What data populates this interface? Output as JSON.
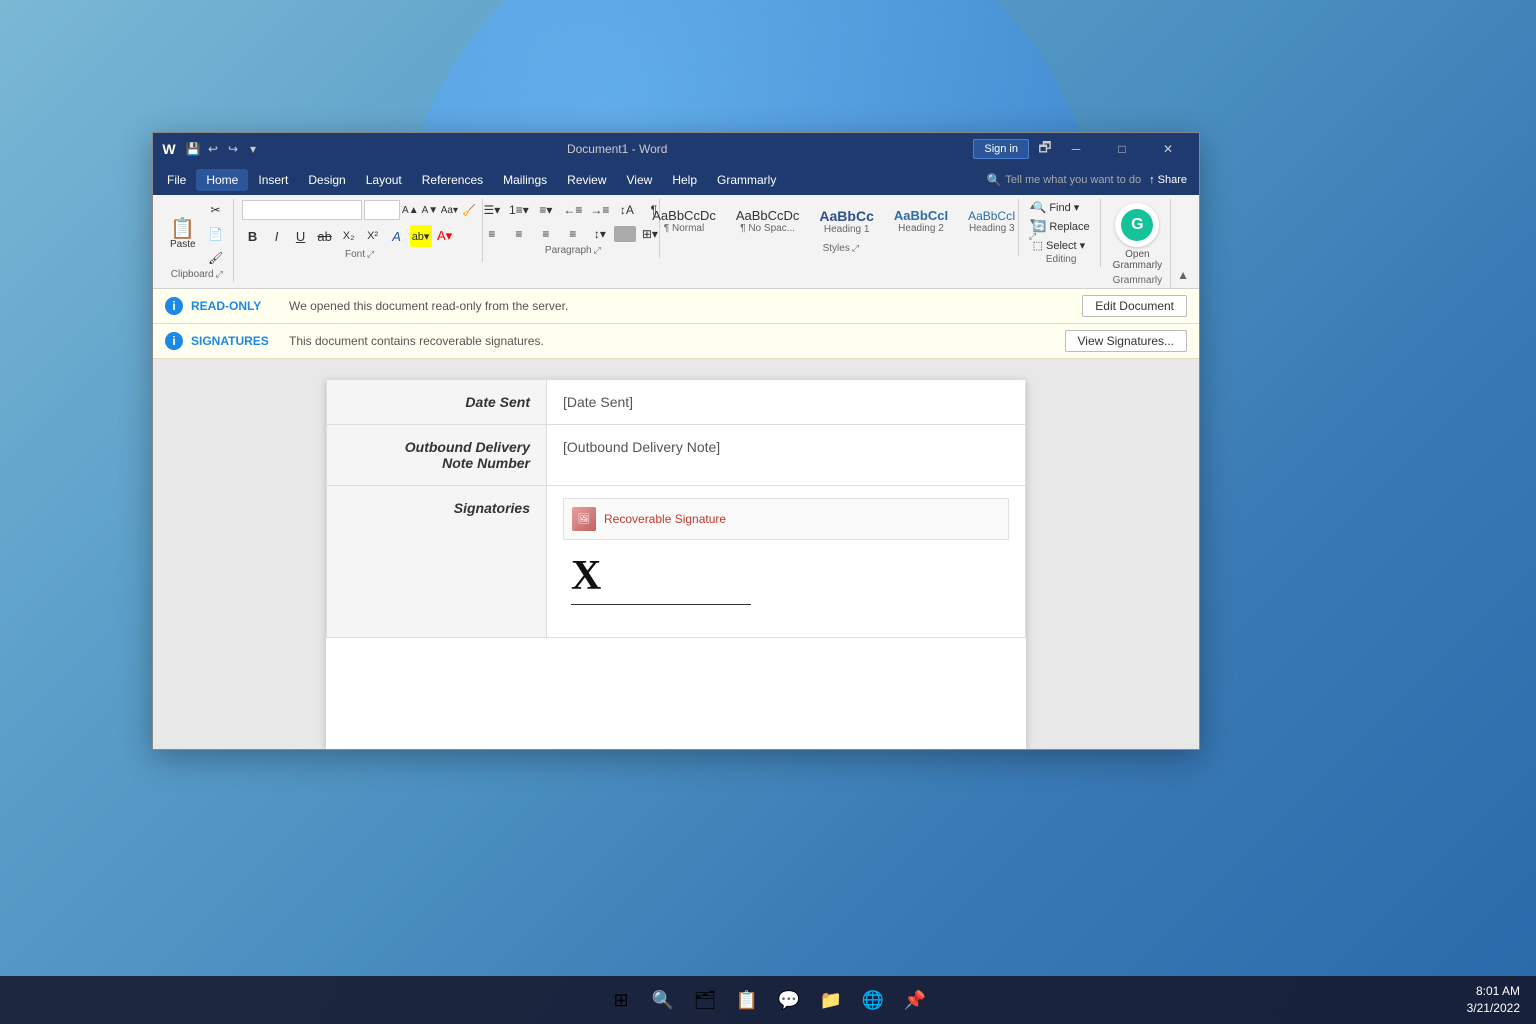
{
  "window": {
    "title": "Document1 - Word",
    "titlebar": {
      "quicksave": "💾",
      "undo": "↩",
      "redo": "↪",
      "more": "▾"
    },
    "controls": {
      "signin_label": "Sign in",
      "restore_label": "🗗",
      "minimize_label": "─",
      "maximize_label": "□",
      "close_label": "✕"
    }
  },
  "menubar": {
    "items": [
      {
        "label": "File",
        "active": false
      },
      {
        "label": "Home",
        "active": true
      },
      {
        "label": "Insert",
        "active": false
      },
      {
        "label": "Design",
        "active": false
      },
      {
        "label": "Layout",
        "active": false
      },
      {
        "label": "References",
        "active": false
      },
      {
        "label": "Mailings",
        "active": false
      },
      {
        "label": "Review",
        "active": false
      },
      {
        "label": "View",
        "active": false
      },
      {
        "label": "Help",
        "active": false
      },
      {
        "label": "Grammarly",
        "active": false
      }
    ],
    "search_placeholder": "Tell me what you want to do",
    "share_label": "Share"
  },
  "ribbon": {
    "groups": [
      {
        "name": "Clipboard",
        "label": "Clipboard"
      },
      {
        "name": "Font",
        "label": "Font"
      },
      {
        "name": "Paragraph",
        "label": "Paragraph"
      },
      {
        "name": "Styles",
        "label": "Styles"
      },
      {
        "name": "Editing",
        "label": "Editing"
      },
      {
        "name": "Grammarly",
        "label": "Grammarly"
      }
    ],
    "font": {
      "name": "",
      "size": ""
    },
    "styles": [
      {
        "label": "¶ Normal",
        "sub": ""
      },
      {
        "label": "¶ No Spac...",
        "sub": ""
      },
      {
        "label": "Heading 1",
        "sub": ""
      },
      {
        "label": "Heading 2",
        "sub": ""
      },
      {
        "label": "Heading 3",
        "sub": ""
      }
    ],
    "editing": [
      {
        "label": "Find ▾"
      },
      {
        "label": "Replace"
      },
      {
        "label": "Select ▾"
      }
    ]
  },
  "notifications": [
    {
      "type": "read-only",
      "icon": "i",
      "label": "READ-ONLY",
      "text": "We opened this document read-only from the server.",
      "button": "Edit Document"
    },
    {
      "type": "signatures",
      "icon": "i",
      "label": "SIGNATURES",
      "text": "This document contains recoverable signatures.",
      "button": "View Signatures..."
    }
  ],
  "document": {
    "rows": [
      {
        "label": "Date Sent",
        "value": "[Date Sent]",
        "type": "text"
      },
      {
        "label": "Outbound Delivery\nNote Number",
        "value": "[Outbound Delivery Note]",
        "type": "text"
      },
      {
        "label": "Signatories",
        "value": "",
        "type": "signature",
        "signature_header": "Recoverable Signature",
        "signature_x": "X"
      }
    ]
  },
  "taskbar": {
    "icons": [
      "⊞",
      "🔍",
      "🗂",
      "📋",
      "💬",
      "📁",
      "🌐",
      "📌"
    ],
    "time": "8:01 AM",
    "date": "3/21/2022"
  }
}
